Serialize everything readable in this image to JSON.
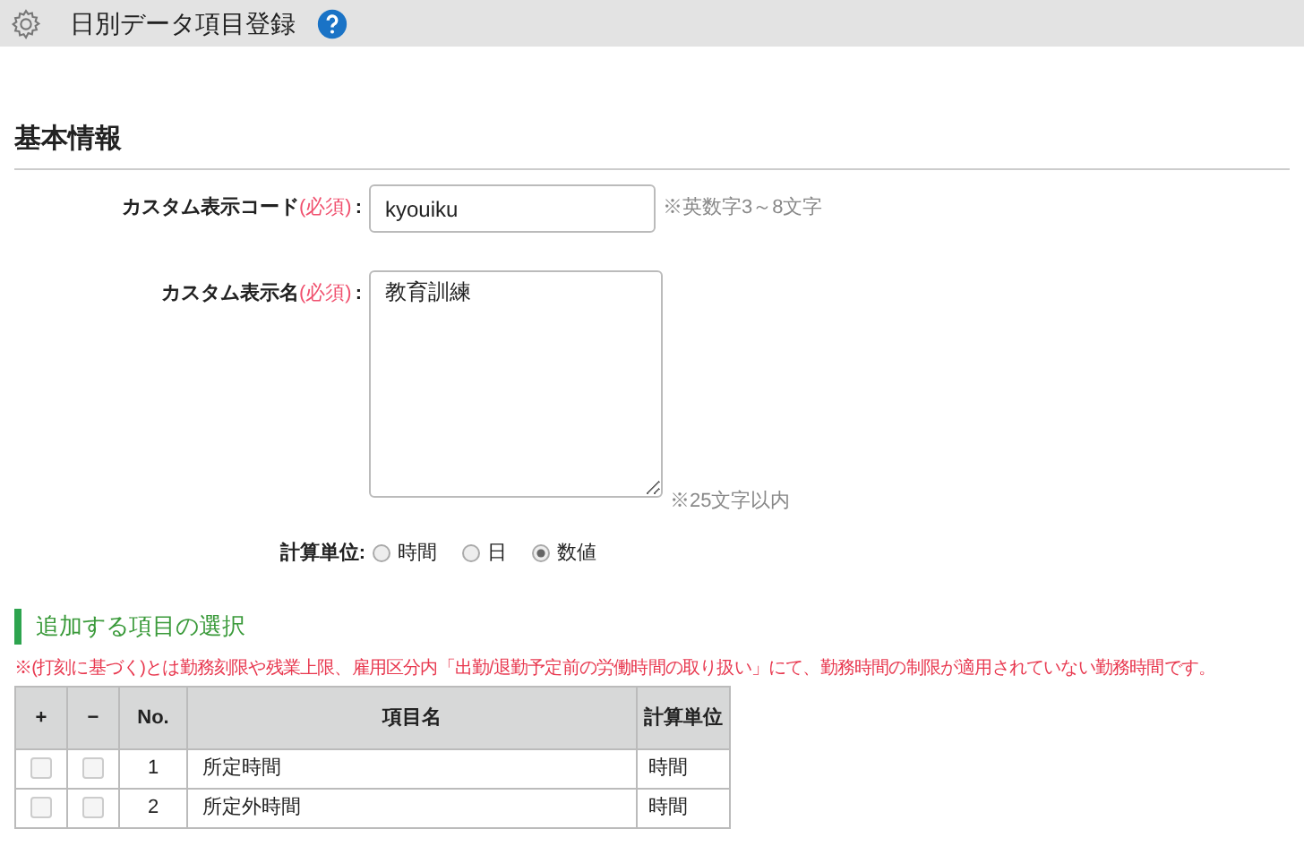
{
  "header": {
    "title": "日別データ項目登録"
  },
  "section": {
    "title": "基本情報"
  },
  "fields": [
    {
      "kind": "input",
      "label": "カスタム表示コード",
      "required": "(必須)",
      "colon": ":",
      "value": "kyouiku",
      "hint": "※英数字3～8文字"
    },
    {
      "kind": "textarea",
      "label": "カスタム表示名",
      "required": "(必須)",
      "colon": ":",
      "value": "教育訓練",
      "hint": "※25文字以内"
    }
  ],
  "unit": {
    "label": "計算単位:",
    "options": [
      {
        "label": "時間",
        "selected": false
      },
      {
        "label": "日",
        "selected": false
      },
      {
        "label": "数値",
        "selected": true
      }
    ]
  },
  "subsection": {
    "title": "追加する項目の選択"
  },
  "note": "※(打刻に基づく)とは勤務刻限や残業上限、雇用区分内「出勤/退勤予定前の労働時間の取り扱い」にて、勤務時間の制限が適用されていない勤務時間です。",
  "table": {
    "columns": [
      "+",
      "−",
      "No.",
      "項目名",
      "計算単位"
    ],
    "rows": [
      {
        "add": false,
        "remove": false,
        "no": "1",
        "name": "所定時間",
        "unit": "時間"
      },
      {
        "add": false,
        "remove": false,
        "no": "2",
        "name": "所定外時間",
        "unit": "時間"
      }
    ]
  }
}
